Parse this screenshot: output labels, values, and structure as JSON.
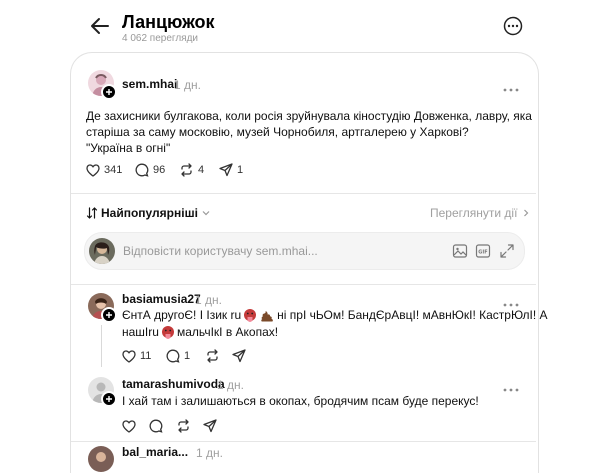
{
  "header": {
    "title": "Ланцюжок",
    "views": "4 062 перегляди"
  },
  "post": {
    "username": "sem.mhai",
    "time": "1 дн.",
    "text_line1": "Де захисники булгакова, коли росія зруйнувала кіностудію Довженка, лавру, яка",
    "text_line2": "старіша за саму московію, музей Чорнобиля, артгалерею у Харкові?",
    "text_line3": "\"Україна в огні\"",
    "likes": "341",
    "comments": "96",
    "reposts": "4",
    "shares": "1"
  },
  "sort": {
    "label": "Найпопулярніші",
    "activity_link": "Переглянути дії"
  },
  "reply": {
    "placeholder": "Відповісти користувачу sem.mhai..."
  },
  "comments": [
    {
      "username": "basiamusia27",
      "time": "1 дн.",
      "text_line1_a": "ЄнтА другоЄ! І Ізик ru",
      "text_line1_b": "ні прІ чЬОм! БандЄрАвцІ! мАвнЮкІ! КастрЮлІ! А",
      "text_line2_a": "нашІru",
      "text_line2_b": "мальчІкІ в Акопах!",
      "likes": "11",
      "comments": "1"
    },
    {
      "username": "tamarashumivoda",
      "time": "1 дн.",
      "text": "І хай там і залишаються в окопах, бродячим псам буде перекус!"
    },
    {
      "username": "bal_maria...",
      "time": "1 дн."
    }
  ],
  "colors": {
    "text": "#101010",
    "muted": "#999999",
    "border": "#e2e2e2",
    "reply_bg": "#f5f5f5"
  }
}
